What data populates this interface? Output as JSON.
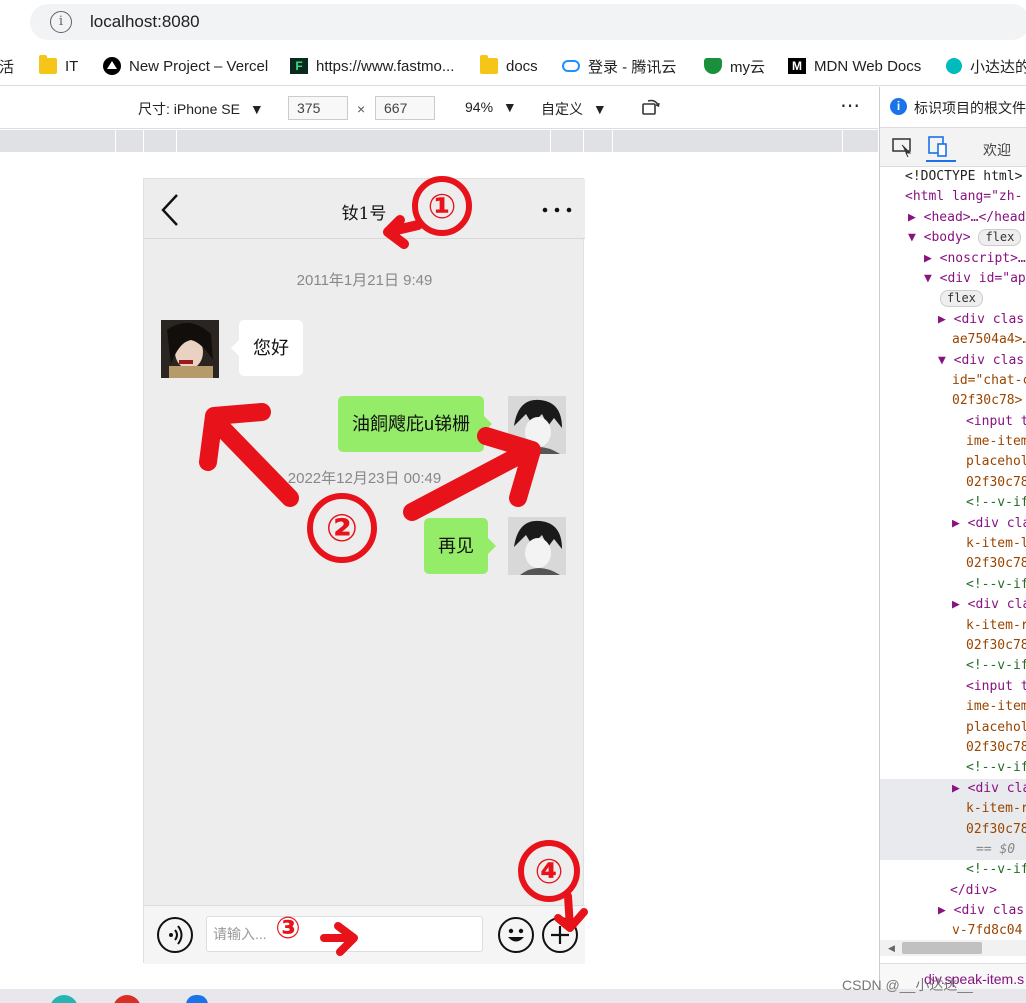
{
  "browser": {
    "url": "localhost:8080",
    "bookmarks": [
      {
        "label": "生活",
        "icon": "folder-icon"
      },
      {
        "label": "IT",
        "icon": "folder-icon"
      },
      {
        "label": "New Project – Vercel",
        "icon": "vercel-icon"
      },
      {
        "label": "https://www.fastmo...",
        "icon": "fastmo-icon"
      },
      {
        "label": "docs",
        "icon": "folder-icon"
      },
      {
        "label": "登录 - 腾讯云",
        "icon": "cloud-icon"
      },
      {
        "label": "my云",
        "icon": "shield-icon"
      },
      {
        "label": "MDN Web Docs",
        "icon": "mdn-icon"
      },
      {
        "label": "小达达的",
        "icon": "circle-icon"
      }
    ]
  },
  "device_toolbar": {
    "size_label": "尺寸: iPhone SE",
    "width": "375",
    "times": "×",
    "height": "667",
    "zoom": "94%",
    "throttle": "自定义"
  },
  "chat": {
    "title": "钕1号",
    "timestamp1": "2011年1月21日  9:49",
    "msg1": "您好",
    "msg2": "油餇飕庇u锑栅",
    "timestamp2": "2022年12月23日  00:49",
    "msg3": "再见",
    "input_placeholder": "请输入..."
  },
  "annotations": [
    "①",
    "②",
    "③",
    "④"
  ],
  "devtools": {
    "info": "标识项目的根文件",
    "welcome_tab": "欢迎",
    "footer_breadcrumb": "div.speak-item.s",
    "lines": [
      "<!DOCTYPE html>",
      "<html lang=\"zh-",
      "▶ <head>…</head>",
      "▼ <body>",
      "flex",
      "▶ <noscript>…",
      "▼ <div id=\"ap",
      "flex",
      "▶ <div clas",
      "ae7504a4>…",
      "▼ <div clas",
      "id=\"chat-c",
      "02f30c78>",
      "<input t",
      "ime-item",
      "placehol",
      "02f30c78",
      "<!--v-if",
      "▶ <div cla",
      "k-item-l",
      "02f30c78",
      "<!--v-if",
      "▶ <div cla",
      "k-item-r",
      "02f30c78",
      "<!--v-if",
      "<input t",
      "ime-item",
      "placehol",
      "02f30c78",
      "<!--v-if",
      "▶ <div cla",
      "k-item-r",
      "02f30c78",
      "== $0",
      "<!--v-if",
      "</div>",
      "▶ <div clas",
      "v-7fd8c04"
    ]
  },
  "watermark": "CSDN @__小达达__",
  "colors": {
    "annotation": "#e8121a",
    "bubble_green": "#95ec69",
    "phone_bg": "#ededed"
  }
}
